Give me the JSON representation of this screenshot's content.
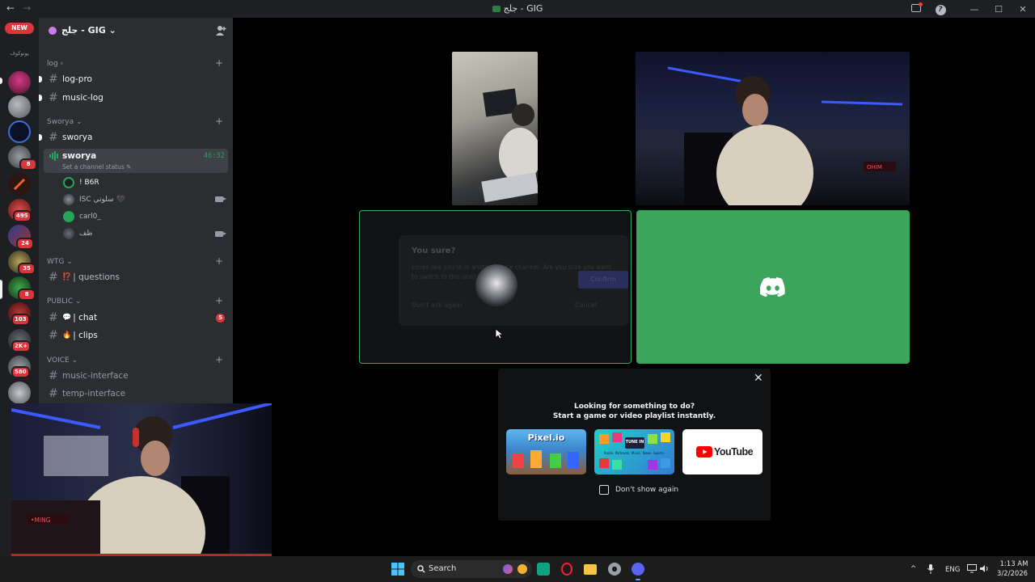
{
  "window": {
    "title": "جلج - GIG",
    "back_arrow": "←",
    "forward_arrow": "→",
    "min_btn": "—",
    "max_btn": "☐",
    "close_btn": "✕"
  },
  "rail": {
    "new_label": "NEW",
    "folder_label": "يوتوكوف",
    "badges": [
      "8",
      "495",
      "24",
      "35",
      "8",
      "103",
      "2K+",
      "580"
    ]
  },
  "guild": {
    "name": "جلج - GIG",
    "chevron": "⌄"
  },
  "categories": {
    "log": "log ›",
    "sworya": "Sworya ⌄",
    "wtg": "WTG ⌄",
    "public": "PUBLIC ⌄",
    "voice": "VOICE ⌄"
  },
  "channels": {
    "log_pro": "log-pro",
    "music_log": "music-log",
    "sworya_text": "sworya",
    "sworya_voice": "sworya",
    "voice_time": "46:32",
    "voice_status": "Set a channel status ✎",
    "questions": "| questions",
    "questions_emoji": "⁉️",
    "chat": "| chat",
    "chat_emoji": "💬",
    "chat_mentions": "5",
    "clips": "| clips",
    "clips_emoji": "🔥",
    "music_interface": "music-interface",
    "temp_interface": "temp-interface"
  },
  "voice_users": [
    {
      "name": "! B6R"
    },
    {
      "name": "ISC سلوتي 🖤"
    },
    {
      "name": "carl0_"
    },
    {
      "name": "ظف"
    }
  ],
  "stage": {
    "dialog_title": "You sure?",
    "dialog_body": "Looks like you're in another voice channel. Are you sure you want to switch to this one?",
    "dialog_checkbox": "Don't ask again",
    "dialog_cancel": "Cancel",
    "dialog_confirm": "Confirm",
    "dialog_close": "✕",
    "cam_overlay_text": "OHIM"
  },
  "activity": {
    "close": "✕",
    "line1": "Looking for something to do?",
    "line2": "Start a game or video playlist instantly.",
    "cards": [
      {
        "label": "Pixel.io"
      },
      {
        "label": "TUNE IN",
        "sub": "Radio. Podcasts. Music. News. Sports."
      },
      {
        "label": "YouTube"
      }
    ],
    "dont_show": "Don't show again"
  },
  "pip": {
    "overlay_text": "•MING"
  },
  "taskbar": {
    "search": "Search",
    "lang": "ENG",
    "time": "1:13 AM",
    "date": "3/2/2026",
    "chevron": "^"
  },
  "colors": {
    "discord_green": "#3ba55c",
    "blurple": "#5865f2",
    "speaking_border": "#3ba55c",
    "mention_red": "#da373c"
  }
}
